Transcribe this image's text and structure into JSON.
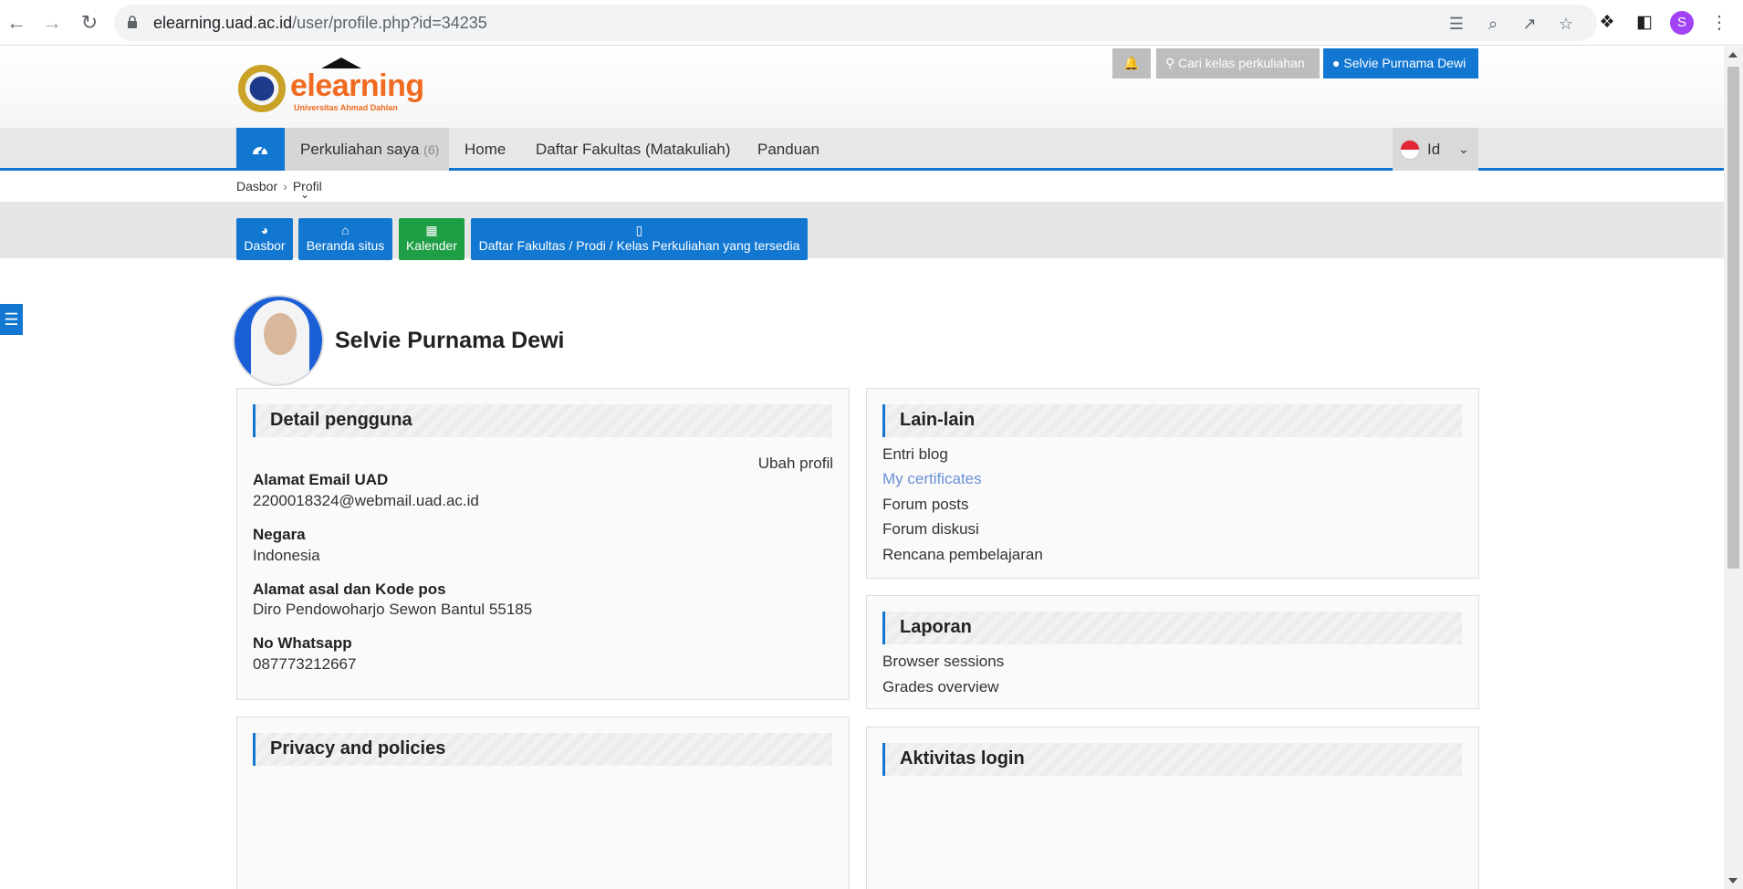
{
  "browser": {
    "url_host": "elearning.uad.ac.id",
    "url_path": "/user/profile.php?id=34235",
    "profile_initial": "S"
  },
  "header": {
    "logo_text": "elearning",
    "logo_subtext": "Universitas Ahmad Dahlan",
    "search_label": "Cari kelas perkuliahan",
    "user_label": "Selvie Purnama Dewi"
  },
  "nav": {
    "my_courses_label": "Perkuliahan saya",
    "my_courses_count": "(6)",
    "home": "Home",
    "faculties": "Daftar Fakultas (Matakuliah)",
    "guide": "Panduan",
    "lang_code": "Id"
  },
  "breadcrumb": {
    "dasbor": "Dasbor",
    "profil": "Profil"
  },
  "quickbar": {
    "dasbor": "Dasbor",
    "beranda": "Beranda situs",
    "kalender": "Kalender",
    "daftar": "Daftar Fakultas / Prodi / Kelas Perkuliahan yang tersedia"
  },
  "profile": {
    "name": "Selvie Purnama Dewi"
  },
  "detail": {
    "title": "Detail pengguna",
    "edit_link": "Ubah profil",
    "email_label": "Alamat Email UAD",
    "email_value": "2200018324@webmail.uad.ac.id",
    "country_label": "Negara",
    "country_value": "Indonesia",
    "address_label": "Alamat asal dan Kode pos",
    "address_value": "Diro Pendowoharjo Sewon Bantul 55185",
    "wa_label": "No Whatsapp",
    "wa_value": "087773212667"
  },
  "privacy": {
    "title": "Privacy and policies"
  },
  "misc": {
    "title": "Lain-lain",
    "items": [
      "Entri blog",
      "My certificates",
      "Forum posts",
      "Forum diskusi",
      "Rencana pembelajaran"
    ]
  },
  "reports": {
    "title": "Laporan",
    "items": [
      "Browser sessions",
      "Grades overview"
    ]
  },
  "login_activity": {
    "title": "Aktivitas login"
  },
  "colors": {
    "primary": "#1177d1",
    "green": "#1e9e45",
    "logo_orange": "#f06a1f"
  }
}
